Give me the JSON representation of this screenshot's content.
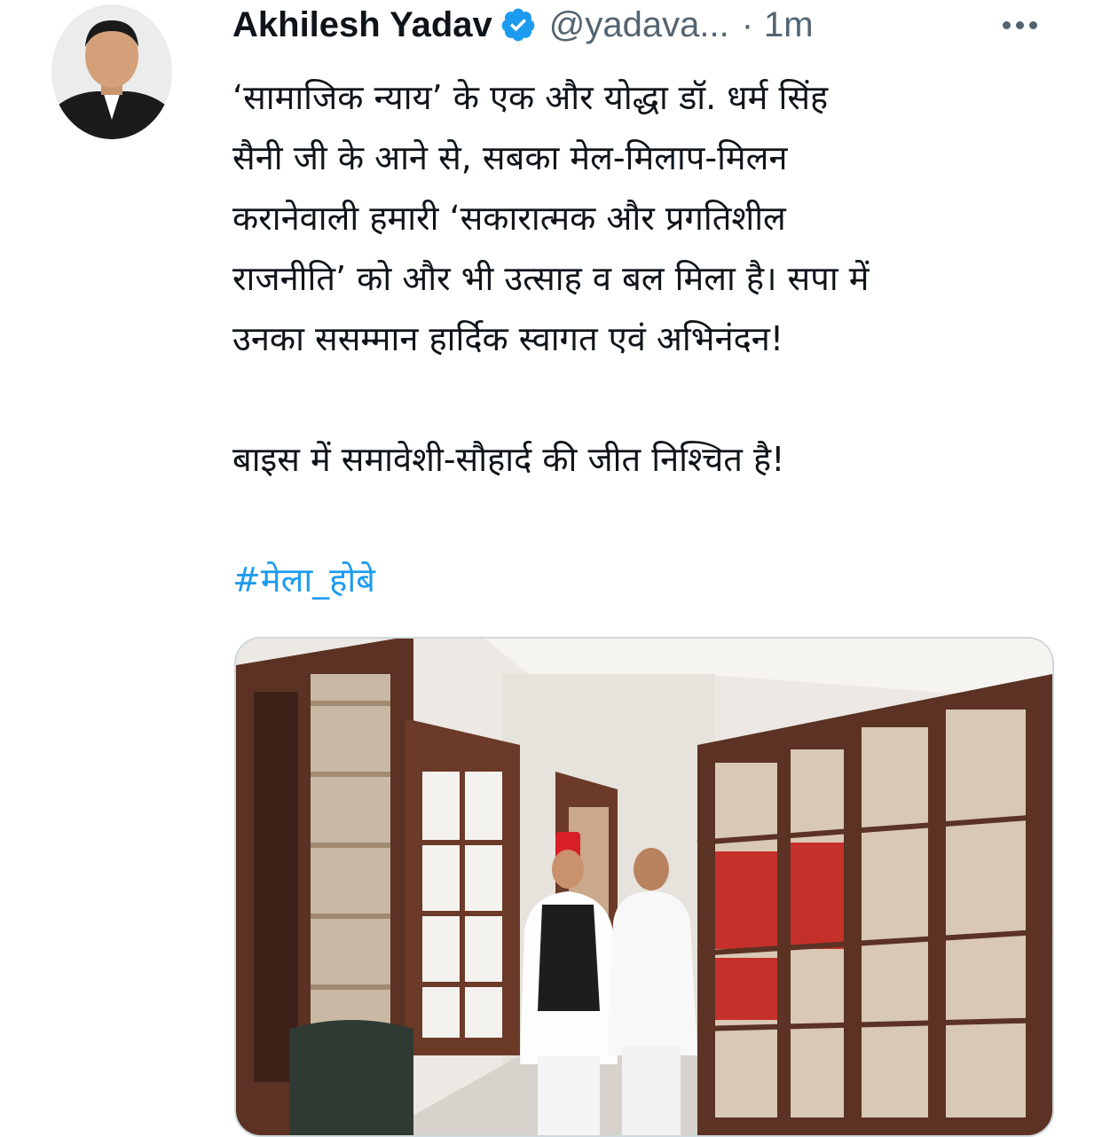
{
  "tweet": {
    "author_name": "Akhilesh Yadav",
    "handle": "@yadava...",
    "separator": "·",
    "time": "1m",
    "verified": true,
    "more_icon": "more-horizontal-icon",
    "lines": [
      "‘सामाजिक न्याय’ के एक और योद्धा डॉ. धर्म सिंह",
      "सैनी जी के आने से, सबका मेल-मिलाप-मिलन",
      "करानेवाली हमारी ‘सकारात्मक और प्रगतिशील",
      "राजनीति’ को और भी उत्साह व बल मिला है। सपा में",
      "उनका ससम्मान हार्दिक स्वागत एवं अभिनंदन!"
    ],
    "line2": "बाइस में समावेशी-सौहार्द की जीत निश्चित है!",
    "hashtag": "#मेला_होबे"
  },
  "colors": {
    "text": "#0f1419",
    "secondary": "#536471",
    "link": "#1d9bf0",
    "verified_badge": "#1d9bf0"
  }
}
